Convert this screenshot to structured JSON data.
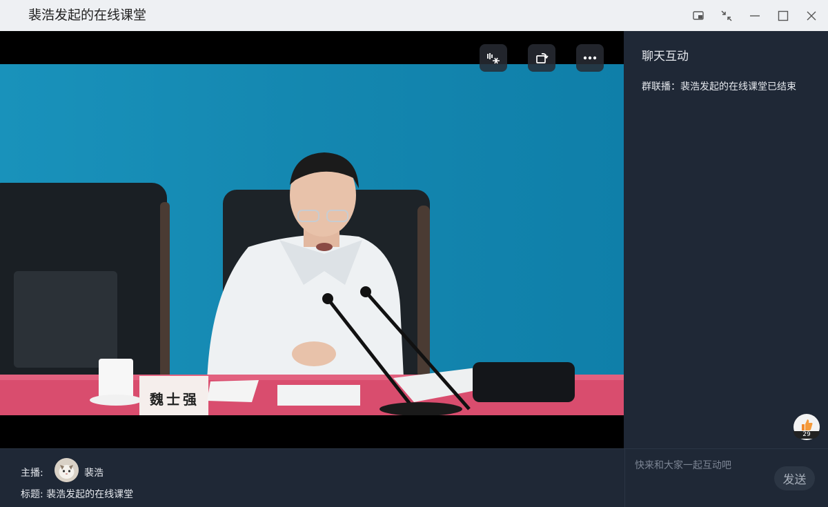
{
  "window": {
    "title": "裴浩发起的在线课堂",
    "icons": [
      "pip-icon",
      "collapse-icon",
      "minimize-icon",
      "maximize-icon",
      "close-icon"
    ]
  },
  "video": {
    "nameplate": "魏士强",
    "controls": [
      "subtitle-icon",
      "rotate-icon",
      "more-icon"
    ]
  },
  "chat": {
    "title": "聊天互动",
    "message": "群联播：裴浩发起的在线课堂已结束",
    "likes": "29",
    "input_placeholder": "快来和大家一起互动吧",
    "send_label": "发送"
  },
  "info": {
    "host_label": "主播:",
    "host_name": "裴浩",
    "subject_label": "标题:",
    "subject_value": "裴浩发起的在线课堂"
  },
  "colors": {
    "backdrop": "#1a8fb5",
    "panel": "#1f2836",
    "tablecloth": "#d94d6e"
  }
}
